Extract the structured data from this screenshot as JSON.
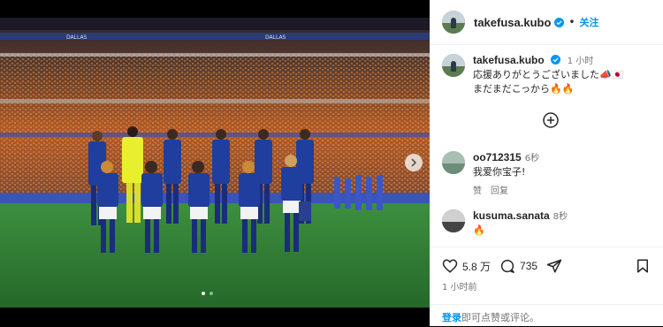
{
  "post": {
    "author": "takefusa.kubo",
    "follow_label": "关注",
    "separator": "•",
    "caption_time": "1 小时",
    "caption_line1": "応援ありがとうございました📣🇯🇵",
    "caption_line2": "まだまだこっから🔥🔥",
    "likes": "5.8 万",
    "comments_count": "735",
    "posted_ago": "1 小时前",
    "login_link": "登录",
    "login_suffix": "即可点赞或评论。"
  },
  "comments": [
    {
      "user": "oo712315",
      "time": "6秒",
      "text": "我爱你宝子!",
      "like_label": "赞",
      "reply_label": "回复"
    },
    {
      "user": "kusuma.sanata",
      "time": "8秒",
      "text": "🔥"
    }
  ],
  "carousel": {
    "dot_count": 2,
    "active_index": 1
  },
  "image": {
    "banner_text": "DALLAS",
    "subject": "team-photo-japan-national-football-team"
  },
  "colors": {
    "accent": "#0095f6",
    "jersey": "#1f3e9e",
    "keeper": "#e8ef2c",
    "pitch": "#2d7a35",
    "crowd": "#c8621f"
  }
}
